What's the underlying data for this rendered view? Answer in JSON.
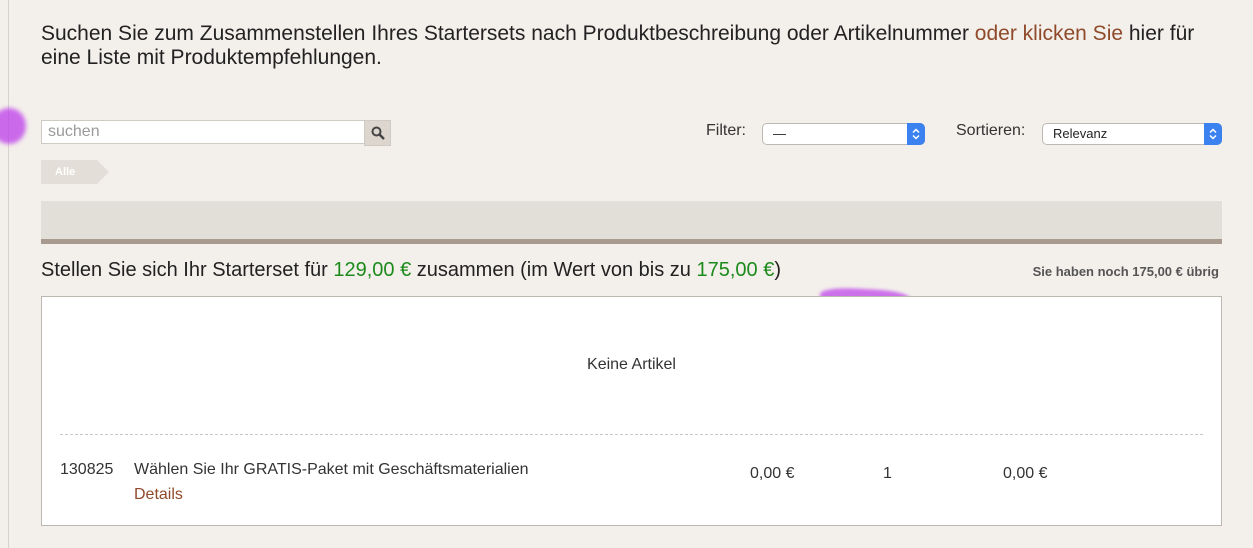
{
  "intro": {
    "text_before": "Suchen Sie zum Zusammenstellen Ihres Startersets nach Produktbeschreibung oder Artikelnummer ",
    "link": "oder klicken Sie",
    "text_after": " hier für eine Liste mit Produktempfehlungen."
  },
  "search": {
    "placeholder": "suchen",
    "value": ""
  },
  "filter": {
    "label": "Filter:",
    "value": "—"
  },
  "sort": {
    "label": "Sortieren:",
    "value": "Relevanz"
  },
  "breadcrumb": {
    "label": "Alle"
  },
  "summary": {
    "prefix": "Stellen Sie sich Ihr Starterset für ",
    "price": "129,00 €",
    "middle": " zusammen (im Wert von bis zu ",
    "value": "175,00 €",
    "suffix": ")",
    "remaining": "Sie haben noch 175,00 € übrig"
  },
  "cart": {
    "empty_message": "Keine Artikel",
    "items": [
      {
        "number": "130825",
        "description": "Wählen Sie Ihr GRATIS-Paket mit Geschäftsmaterialien",
        "details_label": "Details",
        "price": "0,00 €",
        "quantity": "1",
        "total": "0,00 €"
      }
    ]
  },
  "colors": {
    "link": "#8f4a2a",
    "price_green": "#1c8b1c",
    "select_accent": "#3b82f0",
    "highlight": "#be3ceb"
  },
  "icons": {
    "search_button": "search-icon",
    "select_arrows": "updown-chevron-icon"
  }
}
